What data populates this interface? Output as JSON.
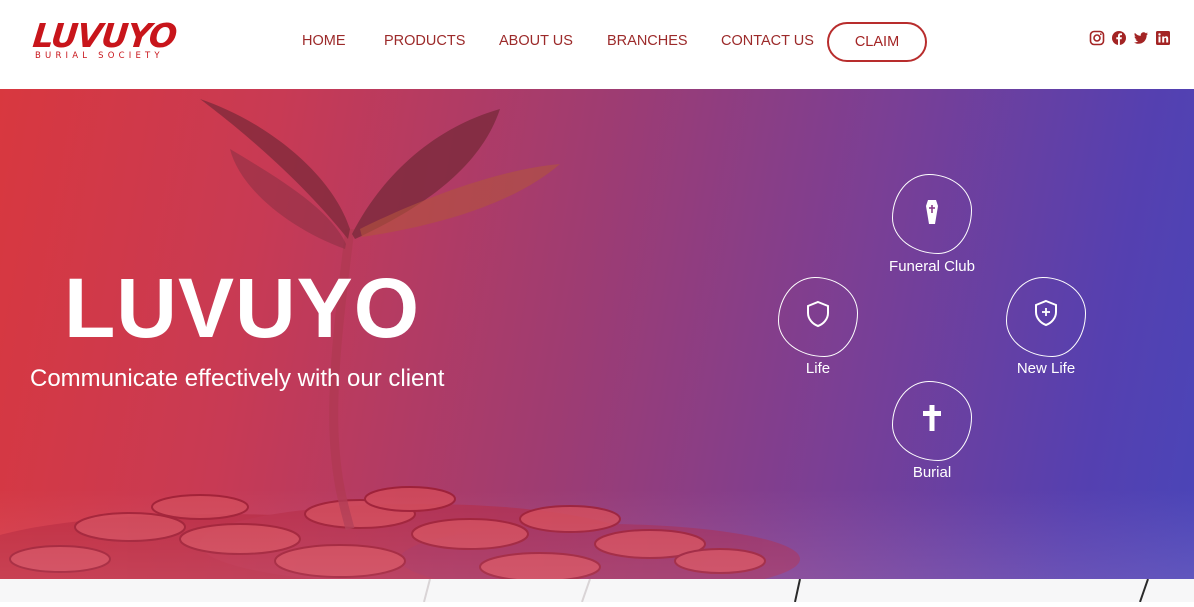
{
  "brand": {
    "logo_main": "LUVUYO",
    "logo_sub": "BURIAL SOCIETY",
    "primary_color": "#c8151b"
  },
  "nav": {
    "items": [
      {
        "label": "HOME"
      },
      {
        "label": "PRODUCTS"
      },
      {
        "label": "ABOUT US"
      },
      {
        "label": "BRANCHES"
      },
      {
        "label": "CONTACT US"
      }
    ],
    "claim_label": "CLAIM"
  },
  "social": [
    {
      "icon": "instagram-icon"
    },
    {
      "icon": "facebook-icon"
    },
    {
      "icon": "twitter-icon"
    },
    {
      "icon": "linkedin-icon"
    }
  ],
  "hero": {
    "title": "LUVUYO",
    "subtitle": "Communicate effectively with our client",
    "services": [
      {
        "label": "Funeral Club",
        "icon": "coffin-icon"
      },
      {
        "label": "Life",
        "icon": "shield-icon"
      },
      {
        "label": "New Life",
        "icon": "shield-plus-icon"
      },
      {
        "label": "Burial",
        "icon": "cross-icon"
      }
    ]
  }
}
